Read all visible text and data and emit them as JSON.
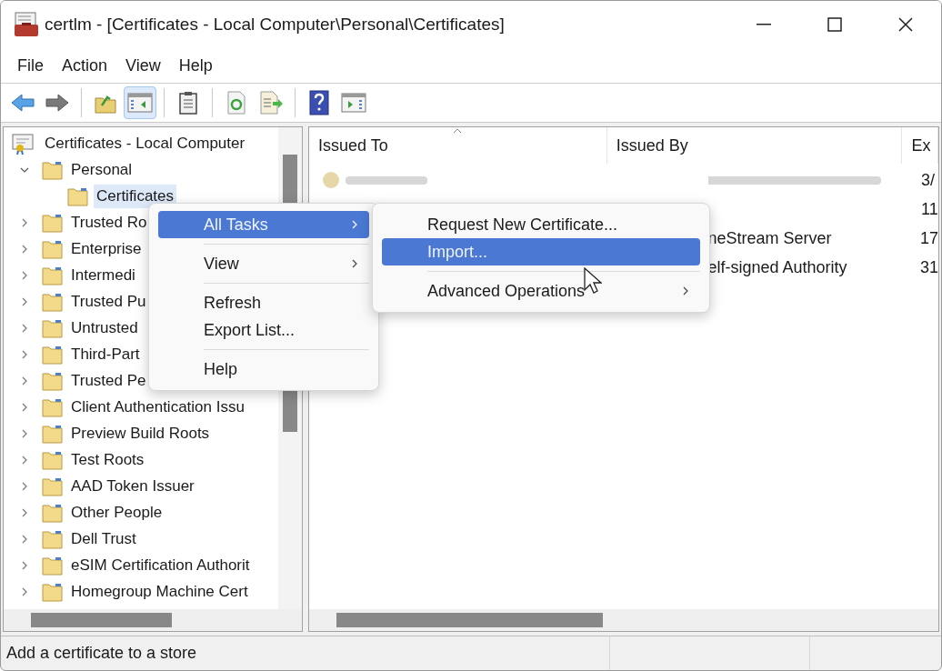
{
  "window": {
    "title": "certlm - [Certificates - Local Computer\\Personal\\Certificates]"
  },
  "menu_bar": [
    "File",
    "Action",
    "View",
    "Help"
  ],
  "toolbar": [
    {
      "kind": "back",
      "selected": false
    },
    {
      "kind": "forward",
      "selected": false
    },
    {
      "kind": "separator"
    },
    {
      "kind": "up",
      "selected": false
    },
    {
      "kind": "tree",
      "selected": true
    },
    {
      "kind": "separator"
    },
    {
      "kind": "properties",
      "selected": false
    },
    {
      "kind": "separator"
    },
    {
      "kind": "refresh",
      "selected": false
    },
    {
      "kind": "export",
      "selected": false
    },
    {
      "kind": "separator"
    },
    {
      "kind": "help",
      "selected": false
    },
    {
      "kind": "action_pane",
      "selected": false
    }
  ],
  "tree": {
    "label": "Certificates - Local Computer",
    "children": [
      {
        "label": "Personal",
        "expanded": true,
        "selected": false,
        "children": [
          {
            "label": "Certificates",
            "selected": true
          }
        ]
      },
      {
        "label": "Trusted Ro",
        "expanded": false,
        "selected": false
      },
      {
        "label": "Enterprise",
        "expanded": false,
        "selected": false
      },
      {
        "label": "Intermedi",
        "expanded": false,
        "selected": false
      },
      {
        "label": "Trusted Pu",
        "expanded": false,
        "selected": false
      },
      {
        "label": "Untrusted",
        "expanded": false,
        "selected": false
      },
      {
        "label": "Third-Part",
        "expanded": false,
        "selected": false
      },
      {
        "label": "Trusted Pe",
        "expanded": false,
        "selected": false
      },
      {
        "label": "Client Authentication Issu",
        "expanded": false,
        "selected": false
      },
      {
        "label": "Preview Build Roots",
        "expanded": false,
        "selected": false
      },
      {
        "label": "Test Roots",
        "expanded": false,
        "selected": false
      },
      {
        "label": "AAD Token Issuer",
        "expanded": false,
        "selected": false
      },
      {
        "label": "Other People",
        "expanded": false,
        "selected": false
      },
      {
        "label": "Dell Trust",
        "expanded": false,
        "selected": false
      },
      {
        "label": "eSIM Certification Authorit",
        "expanded": false,
        "selected": false
      },
      {
        "label": "Homegroup Machine Cert",
        "expanded": false,
        "selected": false
      }
    ]
  },
  "list": {
    "columns": [
      {
        "label": "Issued To",
        "sorted": true
      },
      {
        "label": "Issued By",
        "sorted": false
      },
      {
        "label": "Ex",
        "sorted": false
      }
    ],
    "rows": [
      {
        "blurred": true,
        "expiration": "3/"
      },
      {
        "blurred": false,
        "expiration": "11"
      },
      {
        "blurred": false,
        "issued_by": "neStream Server",
        "expiration": "17"
      },
      {
        "blurred": false,
        "issued_by": "elf-signed Authority",
        "expiration": "31"
      }
    ]
  },
  "context_menu": {
    "items": [
      {
        "kind": "item",
        "label": "All Tasks",
        "submenu": true,
        "selected": true
      },
      {
        "kind": "separator"
      },
      {
        "kind": "item",
        "label": "View",
        "submenu": true,
        "selected": false
      },
      {
        "kind": "separator"
      },
      {
        "kind": "item",
        "label": "Refresh",
        "submenu": false,
        "selected": false
      },
      {
        "kind": "item",
        "label": "Export List...",
        "submenu": false,
        "selected": false
      },
      {
        "kind": "separator"
      },
      {
        "kind": "item",
        "label": "Help",
        "submenu": false,
        "selected": false
      }
    ]
  },
  "submenu": {
    "items": [
      {
        "kind": "item",
        "label": "Request New Certificate...",
        "submenu": false,
        "selected": false
      },
      {
        "kind": "item",
        "label": "Import...",
        "submenu": false,
        "selected": true
      },
      {
        "kind": "separator"
      },
      {
        "kind": "item",
        "label": "Advanced Operations",
        "submenu": true,
        "selected": false
      }
    ]
  },
  "status_bar": {
    "text": "Add a certificate to a store"
  }
}
